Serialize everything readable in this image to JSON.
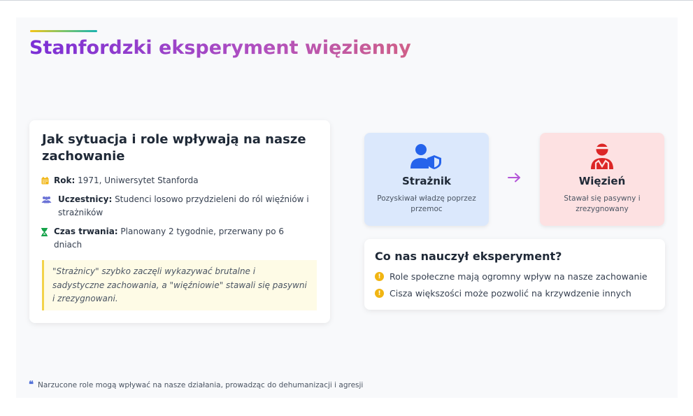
{
  "slide": {
    "title": "Stanfordzki eksperyment więzienny",
    "accent_colors": [
      "#f5c518",
      "#7cc46a",
      "#1bb3b0"
    ],
    "title_gradient": [
      "#7b2fd6",
      "#d06088"
    ]
  },
  "left_card": {
    "heading": "Jak sytuacja i role wpływają na nasze zachowanie",
    "rows": [
      {
        "icon": "calendar-icon",
        "label": "Rok:",
        "text": " 1971, Uniwersytet Stanforda"
      },
      {
        "icon": "users-icon",
        "label": "Uczestnicy:",
        "text": " Studenci losowo przydzieleni do ról więźniów i strażników"
      },
      {
        "icon": "hourglass-icon",
        "label": "Czas trwania:",
        "text": " Planowany 2 tygodnie, przerwany po 6 dniach"
      }
    ],
    "quote": "\"Strażnicy\" szybko zaczęli wykazywać brutalne i sadystyczne zachowania, a \"więźniowie\" stawali się pasywni i zrezygnowani."
  },
  "roles": {
    "guard": {
      "name": "Strażnik",
      "desc": "Pozyskiwał władzę poprzez przemoc",
      "icon": "user-shield-icon",
      "color": "#2563eb"
    },
    "prisoner": {
      "name": "Więzień",
      "desc": "Stawał się pasywny i zrezygnowany",
      "icon": "injured-user-icon",
      "color": "#dc2626"
    },
    "arrow_icon": "arrow-right-icon"
  },
  "lessons": {
    "heading": "Co nas nauczył eksperyment?",
    "items": [
      "Role społeczne mają ogromny wpływ na nasze zachowanie",
      "Cisza większości może pozwolić na krzywdzenie innych"
    ]
  },
  "footer": {
    "icon": "quote-icon",
    "text": "Narzucone role mogą wpływać na nasze działania, prowadząc do dehumanizacji i agresji"
  }
}
